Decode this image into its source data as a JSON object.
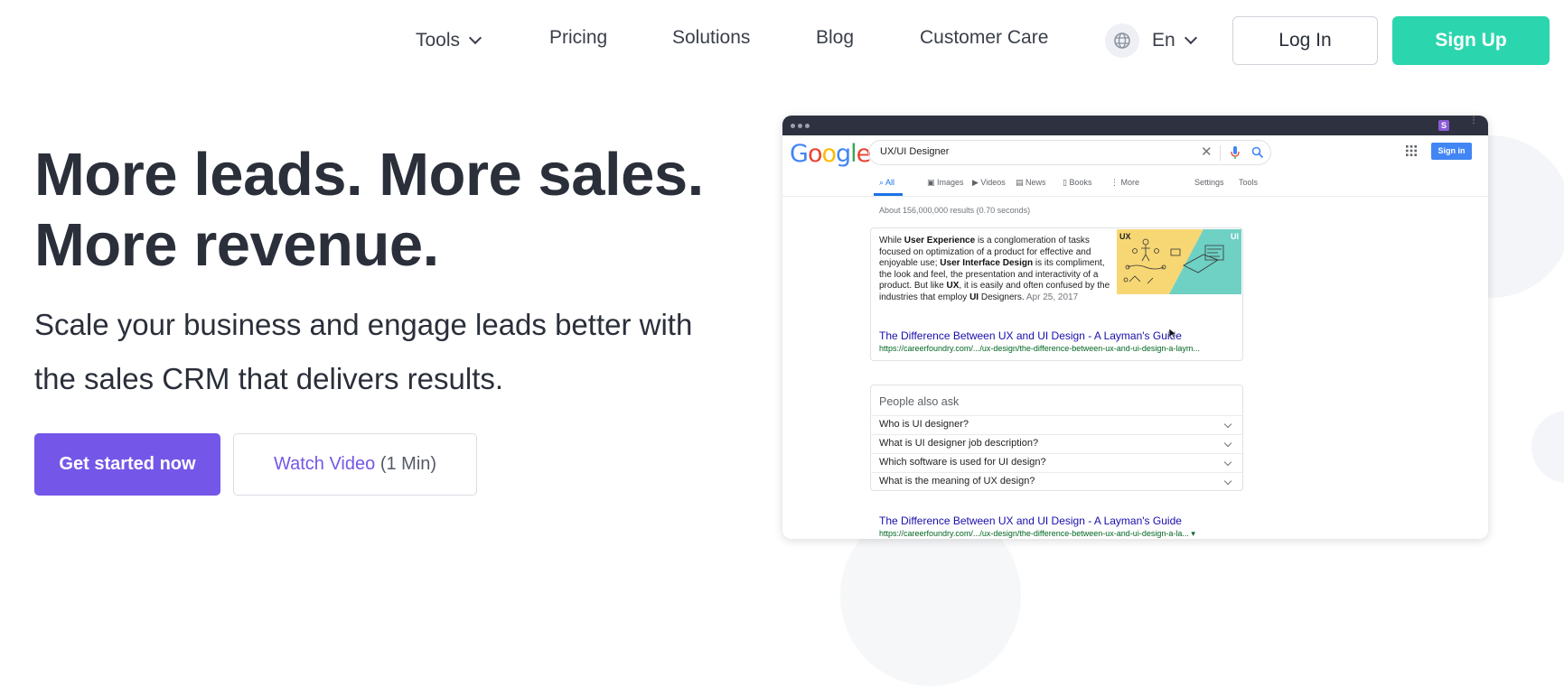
{
  "nav": {
    "tools": "Tools",
    "pricing": "Pricing",
    "solutions": "Solutions",
    "blog": "Blog",
    "customer_care": "Customer Care",
    "language": "En",
    "login": "Log In",
    "signup": "Sign Up"
  },
  "hero": {
    "title_line1": "More leads. More sales.",
    "title_line2": "More revenue.",
    "subtitle_line1": "Scale your business and engage leads better with",
    "subtitle_line2": "the sales CRM that delivers results.",
    "cta_primary": "Get started now",
    "cta_video": "Watch Video",
    "cta_video_duration": "(1 Min)"
  },
  "mockup": {
    "ext_badge": "S",
    "google": {
      "logo_letters": [
        "G",
        "o",
        "o",
        "g",
        "l",
        "e"
      ],
      "logo_colors": [
        "#4285f4",
        "#ea4335",
        "#fbbc05",
        "#4285f4",
        "#34a853",
        "#ea4335"
      ],
      "query": "UX/UI Designer",
      "signin": "Sign in",
      "tabs": [
        "All",
        "Images",
        "Videos",
        "News",
        "Books",
        "More"
      ],
      "settings": "Settings",
      "tools": "Tools",
      "result_count": "About 156,000,000 results (0.70 seconds)",
      "snippet": {
        "p1": "While ",
        "b1": "User Experience",
        "p2": " is a conglomeration of tasks focused on optimization of a product for effective and enjoyable use; ",
        "b2": "User Interface Design",
        "p3": " is its compliment, the look and feel, the presentation and interactivity of a product. But like ",
        "b3": "UX",
        "p4": ", it is easily and often confused by the industries that employ ",
        "b4": "UI",
        "p5": " Designers.",
        "date": " Apr 25, 2017",
        "img_label_left": "UX",
        "img_label_right": "UI"
      },
      "featured_link": "The Difference Between UX and UI Design - A Layman's Guide",
      "featured_url": "https://careerfoundry.com/.../ux-design/the-difference-between-ux-and-ui-design-a-laym...",
      "paa_title": "People also ask",
      "paa_questions": [
        "Who is UI designer?",
        "What is UI designer job description?",
        "Which software is used for UI design?",
        "What is the meaning of UX design?"
      ],
      "second_link": "The Difference Between UX and UI Design - A Layman's Guide",
      "second_url": "https://careerfoundry.com/.../ux-design/the-difference-between-ux-and-ui-design-a-la... ▾"
    }
  },
  "colors": {
    "primary": "#7457e8",
    "signup": "#2bd6ae",
    "text": "#2a2f3a"
  }
}
